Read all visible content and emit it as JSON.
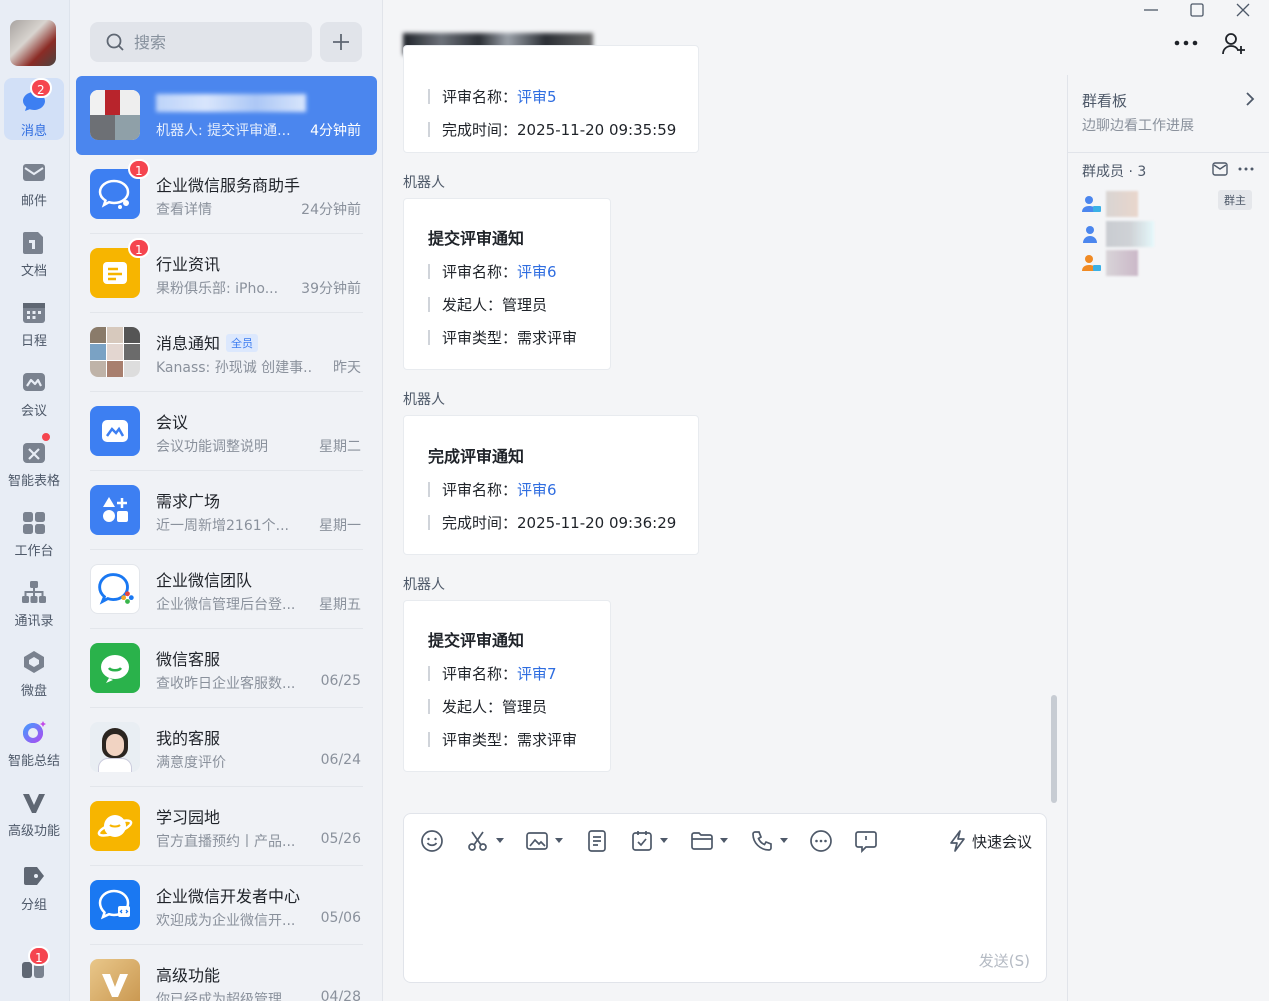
{
  "nav": {
    "items": [
      {
        "label": "消息",
        "icon": "chat-bubble-icon",
        "badge": "2"
      },
      {
        "label": "邮件",
        "icon": "mail-icon"
      },
      {
        "label": "文档",
        "icon": "document-icon"
      },
      {
        "label": "日程",
        "icon": "calendar-icon"
      },
      {
        "label": "会议",
        "icon": "meeting-icon"
      },
      {
        "label": "智能表格",
        "icon": "smart-sheet-icon"
      },
      {
        "label": "工作台",
        "icon": "workbench-grid-icon"
      },
      {
        "label": "通讯录",
        "icon": "contacts-tree-icon"
      },
      {
        "label": "微盘",
        "icon": "cloud-drive-icon"
      },
      {
        "label": "智能总结",
        "icon": "ai-summary-icon"
      },
      {
        "label": "高级功能",
        "icon": "premium-v-icon"
      },
      {
        "label": "分组",
        "icon": "group-tag-icon"
      }
    ],
    "bottom_badge": "1"
  },
  "search": {
    "placeholder": "搜索"
  },
  "conversations": [
    {
      "name": "",
      "preview": "机器人: 提交评审通...",
      "time": "4分钟前",
      "active": true
    },
    {
      "name": "企业微信服务商助手",
      "preview": "查看详情",
      "time": "24分钟前",
      "badge": "1"
    },
    {
      "name": "行业资讯",
      "preview": "果粉俱乐部: iPho...",
      "time": "39分钟前",
      "badge": "1"
    },
    {
      "name": "消息通知",
      "tag": "全员",
      "preview": "Kanass: 孙现诚 创建事...",
      "time": "昨天"
    },
    {
      "name": "会议",
      "preview": "会议功能调整说明",
      "time": "星期二"
    },
    {
      "name": "需求广场",
      "preview": "近一周新增2161个...",
      "time": "星期一"
    },
    {
      "name": "企业微信团队",
      "preview": "企业微信管理后台登...",
      "time": "星期五"
    },
    {
      "name": "微信客服",
      "preview": "查收昨日企业客服数...",
      "time": "06/25"
    },
    {
      "name": "我的客服",
      "preview": "满意度评价",
      "time": "06/24"
    },
    {
      "name": "学习园地",
      "preview": "官方直播预约丨产品...",
      "time": "05/26"
    },
    {
      "name": "企业微信开发者中心",
      "preview": "欢迎成为企业微信开...",
      "time": "05/06"
    },
    {
      "name": "高级功能",
      "preview": "你已经成为超级管理...",
      "time": "04/28"
    }
  ],
  "chat": {
    "title": "",
    "messages": [
      {
        "sender": "",
        "title": "",
        "rows": [
          {
            "label": "评审名称：",
            "value": "评审5",
            "link": true
          },
          {
            "label": "完成时间：",
            "value": "2025-11-20 09:35:59"
          }
        ]
      },
      {
        "sender": "机器人",
        "title": "提交评审通知",
        "rows": [
          {
            "label": "评审名称：",
            "value": "评审6",
            "link": true
          },
          {
            "label": "发起人：",
            "value": "管理员"
          },
          {
            "label": "评审类型：",
            "value": "需求评审"
          }
        ]
      },
      {
        "sender": "机器人",
        "title": "完成评审通知",
        "rows": [
          {
            "label": "评审名称：",
            "value": "评审6",
            "link": true
          },
          {
            "label": "完成时间：",
            "value": "2025-11-20 09:36:29"
          }
        ]
      },
      {
        "sender": "机器人",
        "title": "提交评审通知",
        "rows": [
          {
            "label": "评审名称：",
            "value": "评审7",
            "link": true
          },
          {
            "label": "发起人：",
            "value": "管理员"
          },
          {
            "label": "评审类型：",
            "value": "需求评审"
          }
        ]
      }
    ],
    "composer": {
      "quick_meeting": "快速会议",
      "send": "发送(S)"
    }
  },
  "side": {
    "board_title": "群看板",
    "board_subtitle": "边聊边看工作进展",
    "members_title": "群成员 · 3",
    "owner_tag": "群主"
  },
  "colors": {
    "accent": "#4b86ee",
    "link": "#2f6de0",
    "badge": "#f5454f"
  }
}
